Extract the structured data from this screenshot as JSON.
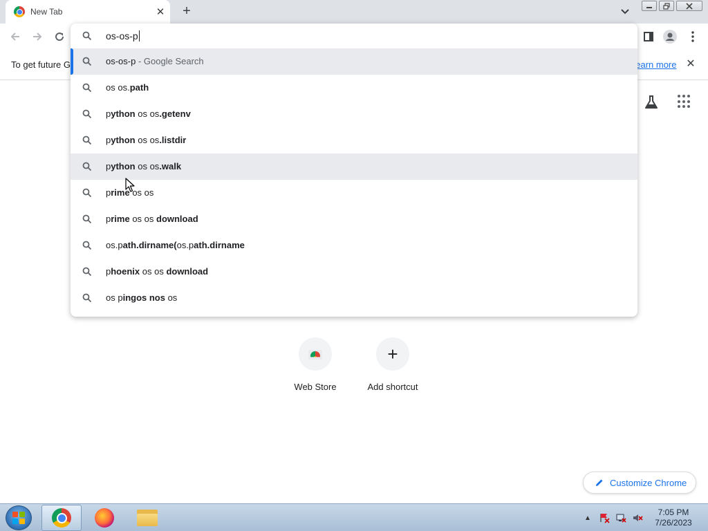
{
  "tab": {
    "title": "New Tab",
    "close_glyph": "✕"
  },
  "tabstrip": {
    "new_tab_glyph": "+"
  },
  "omnibox": {
    "query": "os-os-p"
  },
  "suggestions": [
    {
      "parts": [
        {
          "t": "os-os-p",
          "b": false
        },
        {
          "t": " - Google Search",
          "desc": true
        }
      ]
    },
    {
      "parts": [
        {
          "t": "os os.",
          "b": false
        },
        {
          "t": "path",
          "b": true
        }
      ]
    },
    {
      "parts": [
        {
          "t": "p",
          "b": false
        },
        {
          "t": "ython",
          "b": true
        },
        {
          "t": " os os",
          "b": false
        },
        {
          "t": ".getenv",
          "b": true
        }
      ]
    },
    {
      "parts": [
        {
          "t": "p",
          "b": false
        },
        {
          "t": "ython",
          "b": true
        },
        {
          "t": " os os",
          "b": false
        },
        {
          "t": ".listdir",
          "b": true
        }
      ]
    },
    {
      "parts": [
        {
          "t": "p",
          "b": false
        },
        {
          "t": "ython",
          "b": true
        },
        {
          "t": " os os",
          "b": false
        },
        {
          "t": ".walk",
          "b": true
        }
      ]
    },
    {
      "parts": [
        {
          "t": "p",
          "b": false
        },
        {
          "t": "rime",
          "b": true
        },
        {
          "t": " os os",
          "b": false
        }
      ]
    },
    {
      "parts": [
        {
          "t": "p",
          "b": false
        },
        {
          "t": "rime",
          "b": true
        },
        {
          "t": " os os ",
          "b": false
        },
        {
          "t": "download",
          "b": true
        }
      ]
    },
    {
      "parts": [
        {
          "t": "os.p",
          "b": false
        },
        {
          "t": "ath.dirname(",
          "b": true
        },
        {
          "t": "os.p",
          "b": false
        },
        {
          "t": "ath.dirname",
          "b": true
        }
      ]
    },
    {
      "parts": [
        {
          "t": "p",
          "b": false
        },
        {
          "t": "hoenix",
          "b": true
        },
        {
          "t": " os os ",
          "b": false
        },
        {
          "t": "download",
          "b": true
        }
      ]
    },
    {
      "parts": [
        {
          "t": "os p",
          "b": false
        },
        {
          "t": "ingos nos",
          "b": true
        },
        {
          "t": " os",
          "b": false
        }
      ]
    }
  ],
  "infobar": {
    "message": "To get future G",
    "link": "Learn more",
    "close_glyph": "✕"
  },
  "shortcuts": [
    {
      "label": "Web Store",
      "icon": "web-store-icon"
    },
    {
      "label": "Add shortcut",
      "icon": "plus-icon",
      "glyph": "+"
    }
  ],
  "customize": {
    "label": "Customize Chrome"
  },
  "taskbar": {
    "clock_time": "7:05 PM",
    "clock_date": "7/26/2023",
    "tray_arrow": "▲"
  },
  "colors": {
    "accent": "#1a73e8",
    "highlight_row": "#e8eaed",
    "tab_strip": "#dee1e6"
  }
}
